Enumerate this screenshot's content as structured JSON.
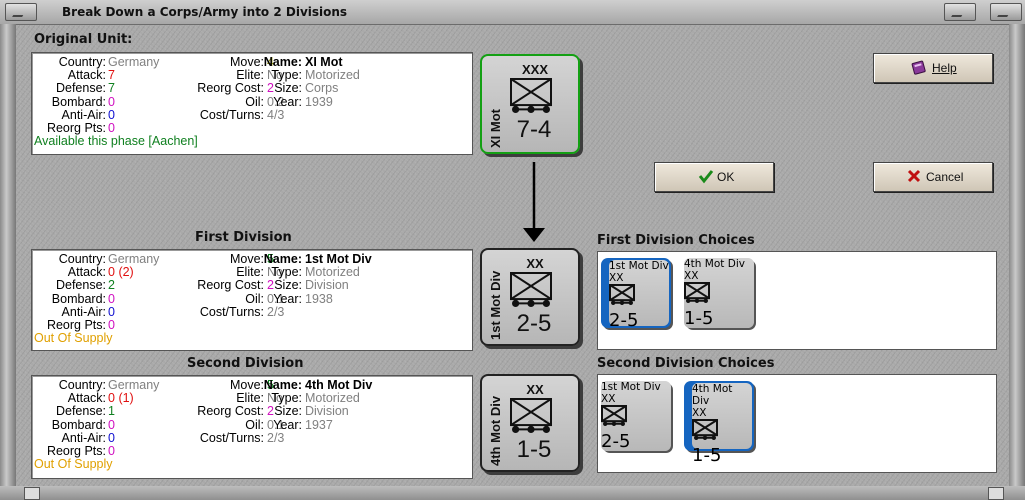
{
  "window": {
    "title": "Break Down a Corps/Army into 2 Divisions"
  },
  "original": {
    "header": "Original Unit:",
    "left_keys": [
      "Country:",
      "Attack:",
      "Defense:",
      "Bombard:",
      "Anti-Air:",
      "Reorg Pts:"
    ],
    "country": "Germany",
    "attack": "7",
    "defense": "7",
    "bombard": "0",
    "anti_air": "0",
    "reorg_pts": "0",
    "mid_keys": [
      "Move:",
      "Elite:",
      "Reorg Cost:",
      "Oil:",
      "Cost/Turns:"
    ],
    "move": "4",
    "elite": "No",
    "reorg_cost": "2",
    "oil": "0.2",
    "cost_turns": "4/3",
    "right_keys": [
      "Name:",
      "Type:",
      "Size:",
      "Year:"
    ],
    "name": "XI Mot",
    "type": "Motorized",
    "size_val": "Corps",
    "year": "1939",
    "status": "Available this phase [Aachen]",
    "counter": {
      "side": "XI Mot",
      "size": "XXX",
      "strength": "7-4"
    }
  },
  "first": {
    "header": "First Division",
    "left_keys": [
      "Country:",
      "Attack:",
      "Defense:",
      "Bombard:",
      "Anti-Air:",
      "Reorg Pts:"
    ],
    "country": "Germany",
    "attack": "0",
    "attack_extra": "(2)",
    "defense": "2",
    "bombard": "0",
    "anti_air": "0",
    "reorg_pts": "0",
    "mid_keys": [
      "Move:",
      "Elite:",
      "Reorg Cost:",
      "Oil:",
      "Cost/Turns:"
    ],
    "move": "5",
    "elite": "No",
    "reorg_cost": "2",
    "oil": "0.1",
    "cost_turns": "2/3",
    "right_keys": [
      "Name:",
      "Type:",
      "Size:",
      "Year:"
    ],
    "name": "1st Mot Div",
    "type": "Motorized",
    "size_val": "Division",
    "year": "1938",
    "status": "Out Of Supply",
    "counter": {
      "side": "1st Mot Div",
      "size": "XX",
      "strength": "2-5"
    }
  },
  "second": {
    "header": "Second Division",
    "left_keys": [
      "Country:",
      "Attack:",
      "Defense:",
      "Bombard:",
      "Anti-Air:",
      "Reorg Pts:"
    ],
    "country": "Germany",
    "attack": "0",
    "attack_extra": "(1)",
    "defense": "1",
    "bombard": "0",
    "anti_air": "0",
    "reorg_pts": "0",
    "mid_keys": [
      "Move:",
      "Elite:",
      "Reorg Cost:",
      "Oil:",
      "Cost/Turns:"
    ],
    "move": "5",
    "elite": "No",
    "reorg_cost": "2",
    "oil": "0.1",
    "cost_turns": "2/3",
    "right_keys": [
      "Name:",
      "Type:",
      "Size:",
      "Year:"
    ],
    "name": "4th Mot Div",
    "type": "Motorized",
    "size_val": "Division",
    "year": "1937",
    "status": "Out Of Supply",
    "counter": {
      "side": "4th Mot Div",
      "size": "XX",
      "strength": "1-5"
    }
  },
  "first_choices": {
    "header": "First Division Choices",
    "items": [
      {
        "side": "1st Mot Div",
        "size": "XX",
        "strength": "2-5"
      },
      {
        "side": "4th Mot Div",
        "size": "XX",
        "strength": "1-5"
      }
    ]
  },
  "second_choices": {
    "header": "Second Division Choices",
    "items": [
      {
        "side": "1st Mot Div",
        "size": "XX",
        "strength": "2-5"
      },
      {
        "side": "4th Mot Div",
        "size": "XX",
        "strength": "1-5"
      }
    ]
  },
  "buttons": {
    "help": "Help",
    "ok": "OK",
    "cancel": "Cancel"
  },
  "icons": {
    "help": "book-icon",
    "ok": "checkmark-icon",
    "cancel": "x-icon"
  },
  "colors": {
    "selected_counter_border": "#13a013",
    "selected_choice": "#1565c0",
    "status_available": "#108020",
    "status_out_of_supply": "#e0a000"
  }
}
